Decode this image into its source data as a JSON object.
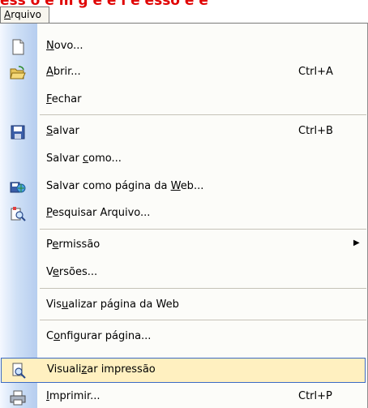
{
  "top_banner": "ess o  e m  g e  e  i e  esso e  e",
  "menu_title": "Arquivo",
  "items": [
    {
      "label": "Novo...",
      "shortcut": "",
      "icon": "new-document-icon"
    },
    {
      "label": "Abrir...",
      "shortcut": "Ctrl+A",
      "icon": "open-folder-icon"
    },
    {
      "label": "Fechar",
      "shortcut": "",
      "icon": ""
    },
    {
      "label": "Salvar",
      "shortcut": "Ctrl+B",
      "icon": "save-disk-icon"
    },
    {
      "label": "Salvar como...",
      "shortcut": "",
      "icon": ""
    },
    {
      "label": "Salvar como página da Web...",
      "shortcut": "",
      "icon": "save-as-web-icon"
    },
    {
      "label": "Pesquisar Arquivo...",
      "shortcut": "",
      "icon": "search-file-icon"
    },
    {
      "label": "Permissão",
      "shortcut": "",
      "icon": "",
      "submenu": true
    },
    {
      "label": "Versões...",
      "shortcut": "",
      "icon": ""
    },
    {
      "label": "Visualizar página da Web",
      "shortcut": "",
      "icon": ""
    },
    {
      "label": "Configurar página...",
      "shortcut": "",
      "icon": ""
    },
    {
      "label": "Visualizar impressão",
      "shortcut": "",
      "icon": "print-preview-icon",
      "highlighted": true
    },
    {
      "label": "Imprimir...",
      "shortcut": "Ctrl+P",
      "icon": "printer-icon"
    }
  ]
}
